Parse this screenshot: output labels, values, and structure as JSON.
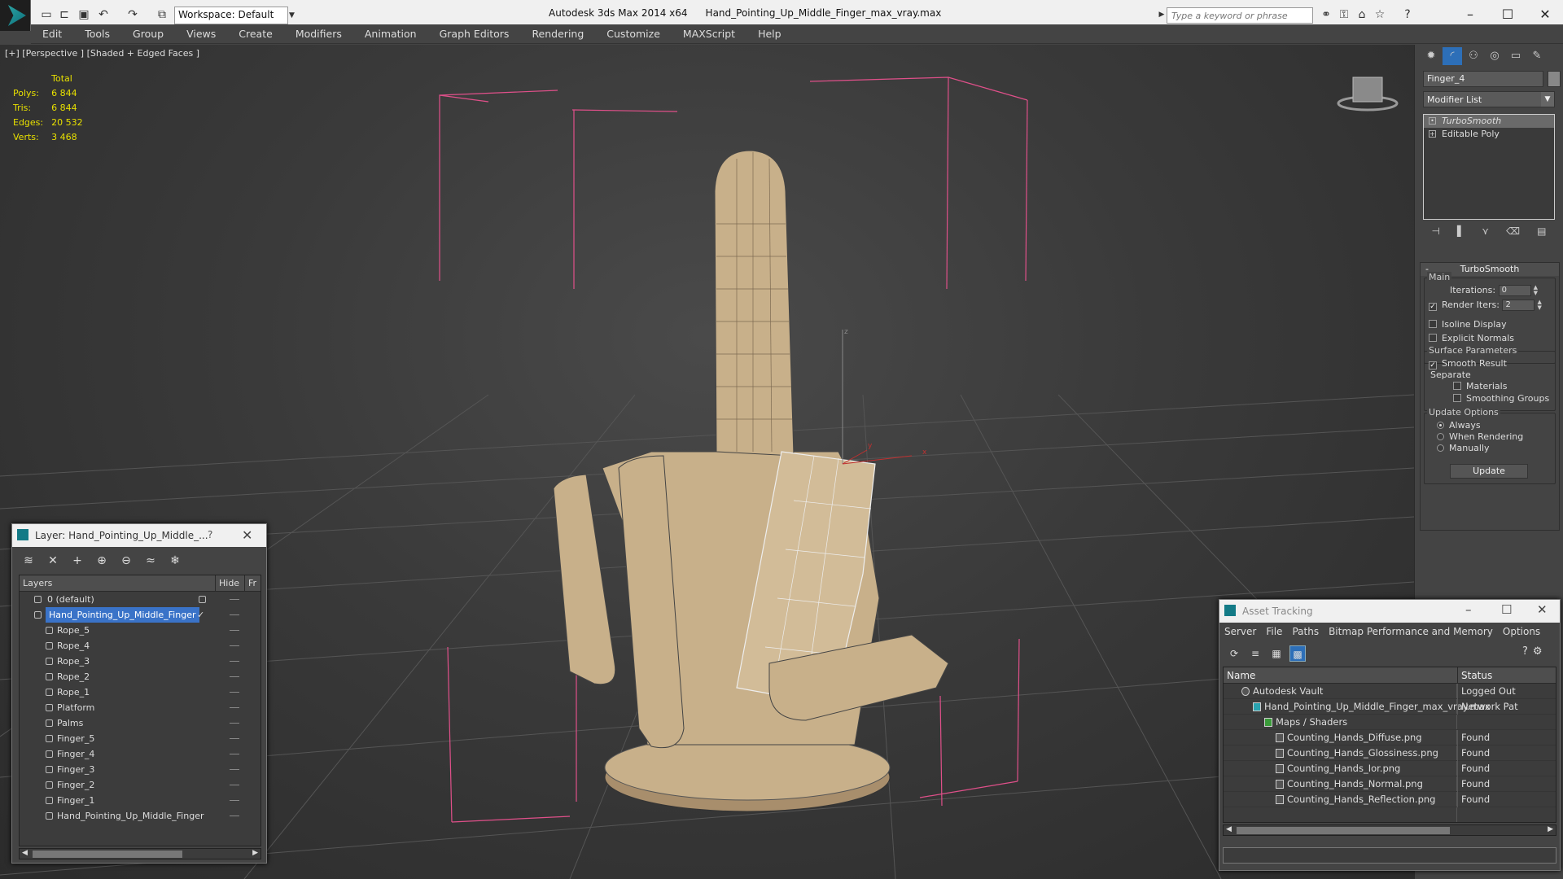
{
  "app": {
    "title": "Autodesk 3ds Max  2014 x64",
    "file": "Hand_Pointing_Up_Middle_Finger_max_vray.max",
    "workspace": "Workspace: Default",
    "search_placeholder": "Type a keyword or phrase"
  },
  "menu": [
    "Edit",
    "Tools",
    "Group",
    "Views",
    "Create",
    "Modifiers",
    "Animation",
    "Graph Editors",
    "Rendering",
    "Customize",
    "MAXScript",
    "Help"
  ],
  "viewport": {
    "label": "[+] [Perspective ] [Shaded + Edged Faces ]",
    "stats_header": "Total",
    "stats": [
      {
        "label": "Polys:",
        "value": "6 844"
      },
      {
        "label": "Tris:",
        "value": "6 844"
      },
      {
        "label": "Edges:",
        "value": "20 532"
      },
      {
        "label": "Verts:",
        "value": "3 468"
      }
    ],
    "axis_z": "z",
    "axis_y": "y",
    "axis_x": "x"
  },
  "command_panel": {
    "object_name": "Finger_4",
    "modifier_list": "Modifier List",
    "stack": [
      "TurboSmooth",
      "Editable Poly"
    ],
    "rollout_title": "TurboSmooth",
    "main_label": "Main",
    "iterations_label": "Iterations:",
    "iterations_value": "0",
    "render_iters_label": "Render Iters:",
    "render_iters_value": "2",
    "isoline_label": "Isoline Display",
    "explicit_label": "Explicit Normals",
    "surface_label": "Surface Parameters",
    "smooth_label": "Smooth Result",
    "separate_label": "Separate",
    "materials_label": "Materials",
    "smoothing_label": "Smoothing Groups",
    "update_options_label": "Update Options",
    "always_label": "Always",
    "when_rendering_label": "When Rendering",
    "manually_label": "Manually",
    "update_button": "Update"
  },
  "layer_dialog": {
    "title": "Layer: Hand_Pointing_Up_Middle_...",
    "help": "?",
    "col_layers": "Layers",
    "col_hide": "Hide",
    "col_fr": "Fr",
    "rows": [
      {
        "name": "0 (default)",
        "level": 0
      },
      {
        "name": "Hand_Pointing_Up_Middle_Finger",
        "level": 0,
        "selected": true
      },
      {
        "name": "Rope_5",
        "level": 1
      },
      {
        "name": "Rope_4",
        "level": 1
      },
      {
        "name": "Rope_3",
        "level": 1
      },
      {
        "name": "Rope_2",
        "level": 1
      },
      {
        "name": "Rope_1",
        "level": 1
      },
      {
        "name": "Platform",
        "level": 1
      },
      {
        "name": "Palms",
        "level": 1
      },
      {
        "name": "Finger_5",
        "level": 1
      },
      {
        "name": "Finger_4",
        "level": 1
      },
      {
        "name": "Finger_3",
        "level": 1
      },
      {
        "name": "Finger_2",
        "level": 1
      },
      {
        "name": "Finger_1",
        "level": 1
      },
      {
        "name": "Hand_Pointing_Up_Middle_Finger",
        "level": 1
      }
    ]
  },
  "asset_dialog": {
    "title": "Asset Tracking",
    "menu": [
      "Server",
      "File",
      "Paths",
      "Bitmap Performance and Memory",
      "Options"
    ],
    "col_name": "Name",
    "col_status": "Status",
    "rows": [
      {
        "name": "Autodesk Vault",
        "status": "Logged Out",
        "indent": 0
      },
      {
        "name": "Hand_Pointing_Up_Middle_Finger_max_vray.max",
        "status": "Network Pat",
        "indent": 1
      },
      {
        "name": "Maps / Shaders",
        "status": "",
        "indent": 2
      },
      {
        "name": "Counting_Hands_Diffuse.png",
        "status": "Found",
        "indent": 3
      },
      {
        "name": "Counting_Hands_Glossiness.png",
        "status": "Found",
        "indent": 3
      },
      {
        "name": "Counting_Hands_Ior.png",
        "status": "Found",
        "indent": 3
      },
      {
        "name": "Counting_Hands_Normal.png",
        "status": "Found",
        "indent": 3
      },
      {
        "name": "Counting_Hands_Reflection.png",
        "status": "Found",
        "indent": 3
      }
    ]
  },
  "colors": {
    "accent": "#3a73c8",
    "stats": "#e8e000",
    "frame": "#e0508a",
    "model": "#c8b08a"
  }
}
